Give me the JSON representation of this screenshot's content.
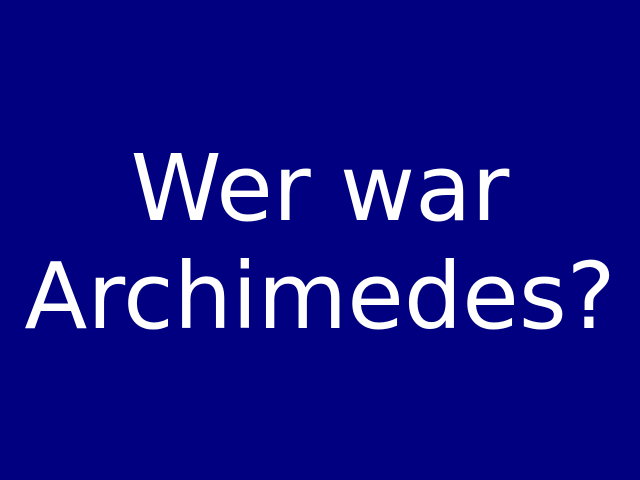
{
  "slide": {
    "lines": [
      "Wer war",
      "Archimedes?"
    ],
    "background_color": "#000080",
    "text_color": "#ffffff"
  }
}
